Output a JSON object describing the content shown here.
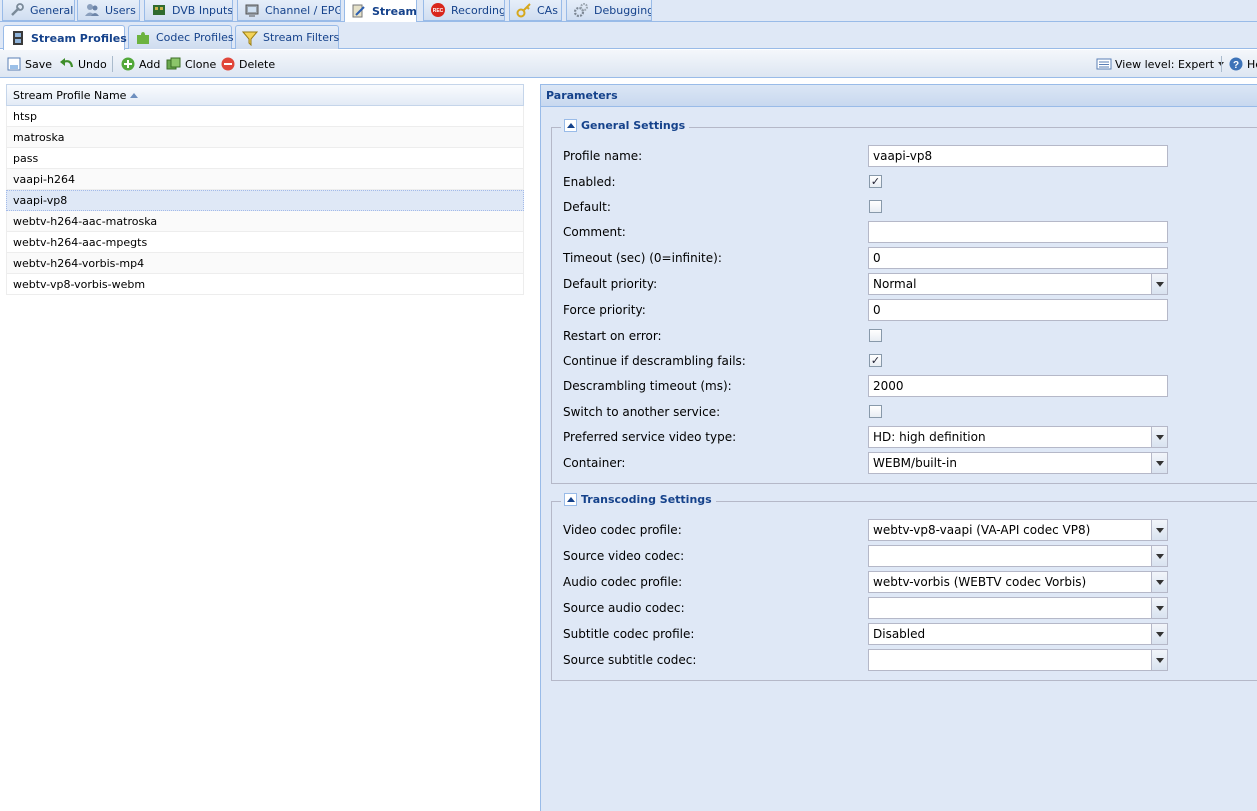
{
  "top_tabs": [
    {
      "label": "General",
      "icon": "wrench-icon"
    },
    {
      "label": "Users",
      "icon": "users-icon"
    },
    {
      "label": "DVB Inputs",
      "icon": "dvb-card-icon"
    },
    {
      "label": "Channel / EPG",
      "icon": "tv-icon"
    },
    {
      "label": "Stream",
      "icon": "stream-icon",
      "active": true
    },
    {
      "label": "Recording",
      "icon": "rec-icon"
    },
    {
      "label": "CAs",
      "icon": "key-icon"
    },
    {
      "label": "Debugging",
      "icon": "gears-icon"
    }
  ],
  "sub_tabs": [
    {
      "label": "Stream Profiles",
      "icon": "film-icon",
      "active": true
    },
    {
      "label": "Codec Profiles",
      "icon": "puzzle-icon"
    },
    {
      "label": "Stream Filters",
      "icon": "filter-icon"
    }
  ],
  "toolbar": {
    "save": "Save",
    "undo": "Undo",
    "add": "Add",
    "clone": "Clone",
    "delete": "Delete",
    "view_level": "View level: Expert",
    "help": "Help"
  },
  "grid": {
    "column": "Stream Profile Name",
    "rows": [
      "htsp",
      "matroska",
      "pass",
      "vaapi-h264",
      "vaapi-vp8",
      "webtv-h264-aac-matroska",
      "webtv-h264-aac-mpegts",
      "webtv-h264-vorbis-mp4",
      "webtv-vp8-vorbis-webm"
    ],
    "selected": "vaapi-vp8"
  },
  "params": {
    "title": "Parameters",
    "general": {
      "legend": "General Settings",
      "profile_name_label": "Profile name:",
      "profile_name": "vaapi-vp8",
      "enabled_label": "Enabled:",
      "enabled": true,
      "default_label": "Default:",
      "default": false,
      "comment_label": "Comment:",
      "comment": "",
      "timeout_label": "Timeout (sec) (0=infinite):",
      "timeout": "0",
      "default_priority_label": "Default priority:",
      "default_priority": "Normal",
      "force_priority_label": "Force priority:",
      "force_priority": "0",
      "restart_label": "Restart on error:",
      "restart": false,
      "continue_label": "Continue if descrambling fails:",
      "continue": true,
      "descr_timeout_label": "Descrambling timeout (ms):",
      "descr_timeout": "2000",
      "switch_label": "Switch to another service:",
      "switch": false,
      "pref_video_label": "Preferred service video type:",
      "pref_video": "HD: high definition",
      "container_label": "Container:",
      "container": "WEBM/built-in"
    },
    "transcoding": {
      "legend": "Transcoding Settings",
      "video_codec_label": "Video codec profile:",
      "video_codec": "webtv-vp8-vaapi (VA-API codec VP8)",
      "source_video_label": "Source video codec:",
      "source_video": "",
      "audio_codec_label": "Audio codec profile:",
      "audio_codec": "webtv-vorbis (WEBTV codec Vorbis)",
      "source_audio_label": "Source audio codec:",
      "source_audio": "",
      "subtitle_codec_label": "Subtitle codec profile:",
      "subtitle_codec": "Disabled",
      "source_subtitle_label": "Source subtitle codec:",
      "source_subtitle": ""
    }
  }
}
